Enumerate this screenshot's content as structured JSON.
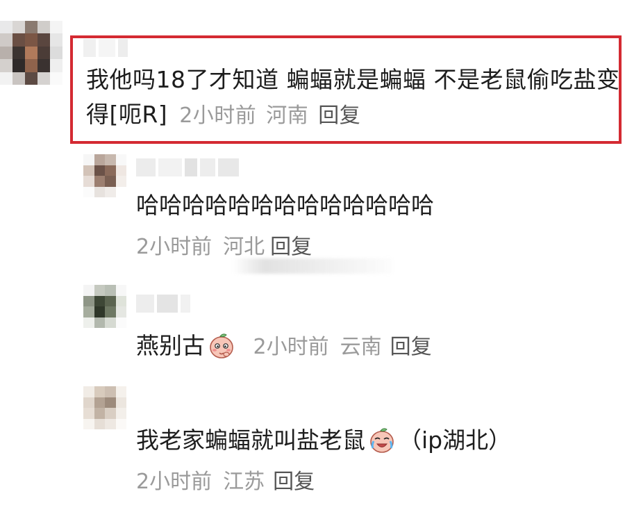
{
  "main_comment": {
    "text": "我他吗18了才知道 蝙蝠就是蝙蝠 不是老鼠偷吃盐变得[呃R]",
    "time": "2小时前",
    "location": "河南",
    "reply_label": "回复",
    "highlight_color": "#d42a32"
  },
  "replies": [
    {
      "text": "哈哈哈哈哈哈哈哈哈哈哈哈哈",
      "time": "2小时前",
      "location": "河北",
      "reply_label": "回复"
    },
    {
      "text": "燕别古",
      "emoji": "peach-cheeky-emoji",
      "time": "2小时前",
      "location": "云南",
      "reply_label": "回复"
    },
    {
      "text_before": "我老家蝙蝠就叫盐老鼠",
      "emoji": "peach-crying-laugh-emoji",
      "text_after": "（ip湖北）",
      "time": "2小时前",
      "location": "江苏",
      "reply_label": "回复"
    }
  ]
}
